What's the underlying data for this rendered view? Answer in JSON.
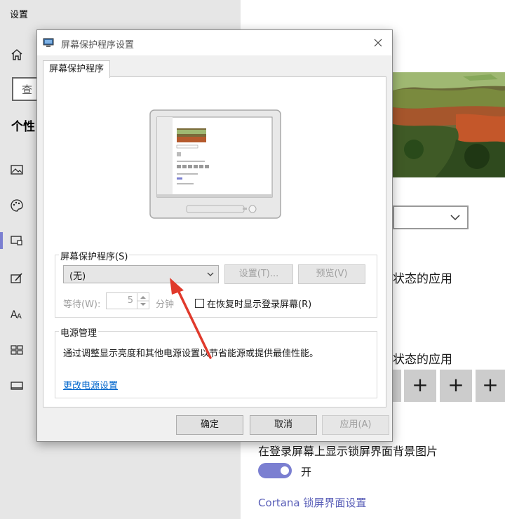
{
  "settings": {
    "title": "设置",
    "search_text": "查",
    "section_heading": "个性",
    "nav_icons": [
      "home-icon",
      "picture-icon",
      "palette-icon",
      "lockscreen-icon",
      "theme-brush-icon",
      "font-icon",
      "start-icon",
      "taskbar-icon"
    ],
    "right": {
      "status_apps_1": "状态的应用",
      "status_apps_2": "状态的应用",
      "plus_symbol": "+",
      "show_bg_label": "在登录屏幕上显示锁屏界面背景图片",
      "toggle_state": "开",
      "cortana_link": "Cortana 锁屏界面设置"
    }
  },
  "dialog": {
    "title": "屏幕保护程序设置",
    "tab_label": "屏幕保护程序",
    "screensaver_group_label": "屏幕保护程序(S)",
    "screensaver_selected": "(无)",
    "settings_button": "设置(T)...",
    "preview_button": "预览(V)",
    "wait_label": "等待(W):",
    "wait_value": "5",
    "minutes_label": "分钟",
    "resume_checkbox_label": "在恢复时显示登录屏幕(R)",
    "resume_checked": false,
    "power_group_label": "电源管理",
    "power_description": "通过调整显示亮度和其他电源设置以节省能源或提供最佳性能。",
    "power_link": "更改电源设置",
    "ok_button": "确定",
    "cancel_button": "取消",
    "apply_button": "应用(A)"
  },
  "colors": {
    "accent": "#7b7fd1",
    "annotation_arrow": "#e03a2c",
    "link": "#0066cc"
  }
}
